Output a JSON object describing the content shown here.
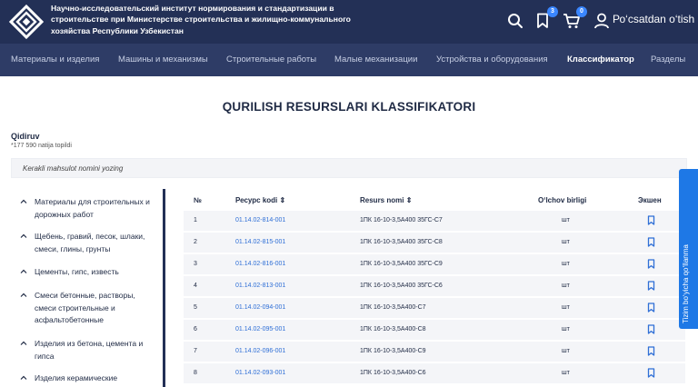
{
  "header": {
    "org_name": "Научно-исследовательский институт нормирования и стандартизации в строительстве при Министерстве строительства и жилищно-коммунального хозяйства Республики Узбекистан",
    "favorites_count": "3",
    "cart_count": "0",
    "login_label": "Ро‘сѕatdan o‘tish",
    "icons": [
      "logo-icon",
      "search-icon",
      "bookmark-icon",
      "cart-icon",
      "user-icon"
    ],
    "colors": {
      "header_bg": "#233056",
      "nav_bg": "#2e3c66",
      "accent": "#1e78e6",
      "link": "#2f6fd6"
    }
  },
  "nav": {
    "items": [
      "Материалы и изделия",
      "Машины и механизмы",
      "Строительные работы",
      "Малые механизации",
      "Устройства и оборудования",
      "Классификатор",
      "Разделы"
    ],
    "active": "Классификатор"
  },
  "page": {
    "title": "QURILISH RESURSLARI KLASSIFIKATORI",
    "search_label": "Qidiruv",
    "result_count": "*177 590 natija topildi",
    "search_placeholder": "Kerakli mahsulot nomini yozing"
  },
  "sidebar": {
    "items": [
      "Материалы для строительных и дорожных работ",
      "Щебень, гравий, песок, шлаки, смеси, глины, грунты",
      "Цементы, гипс, известь",
      "Смеси бетонные, растворы, смеси строительные и асфальтобетонные",
      "Изделия из бетона, цемента и гипса",
      "Изделия керамические"
    ]
  },
  "table": {
    "headers": {
      "num": "№",
      "code": "Ресурс kodi",
      "name": "Resurs nomi",
      "unit": "O‘lchov birligi",
      "action": "Экшен"
    },
    "rows": [
      {
        "num": "1",
        "code": "01.14.02-814-001",
        "name": "1ПК 16-10-3,5А400 35ГС-С7",
        "unit": "шт"
      },
      {
        "num": "2",
        "code": "01.14.02-815-001",
        "name": "1ПК 16-10-3,5А400 35ГС-С8",
        "unit": "шт"
      },
      {
        "num": "3",
        "code": "01.14.02-816-001",
        "name": "1ПК 16-10-3,5А400 35ГС-С9",
        "unit": "шт"
      },
      {
        "num": "4",
        "code": "01.14.02-813-001",
        "name": "1ПК 16-10-3,5А400 35ГС-С6",
        "unit": "шт"
      },
      {
        "num": "5",
        "code": "01.14.02-094-001",
        "name": "1ПК 16-10-3,5А400-С7",
        "unit": "шт"
      },
      {
        "num": "6",
        "code": "01.14.02-095-001",
        "name": "1ПК 16-10-3,5А400-С8",
        "unit": "шт"
      },
      {
        "num": "7",
        "code": "01.14.02-096-001",
        "name": "1ПК 16-10-3,5А400-С9",
        "unit": "шт"
      },
      {
        "num": "8",
        "code": "01.14.02-093-001",
        "name": "1ПК 16-10-3,5А400-С6",
        "unit": "шт"
      }
    ]
  },
  "side_tab": {
    "label": "Tizim bo‘yicha qo‘llanma"
  }
}
